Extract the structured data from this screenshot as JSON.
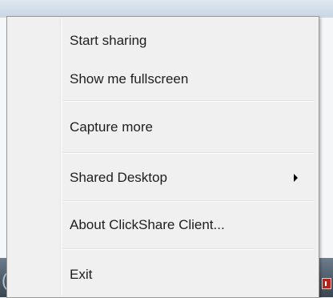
{
  "menu": {
    "items": [
      {
        "label": "Start sharing"
      },
      {
        "label": "Show me fullscreen"
      },
      {
        "label": "Capture more"
      },
      {
        "label": "Shared Desktop",
        "has_submenu": true
      },
      {
        "label": "About ClickShare Client..."
      },
      {
        "label": "Exit"
      }
    ]
  },
  "tray": {
    "icon": "clickshare-tray-icon"
  },
  "colors": {
    "menu_background": "#f0f0f0",
    "menu_border": "#979797",
    "taskbar": "#4b5967"
  }
}
